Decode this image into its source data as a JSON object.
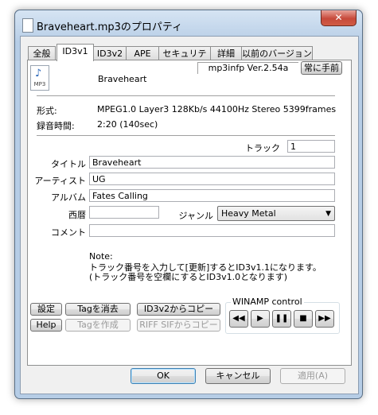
{
  "window": {
    "title": "Braveheart.mp3のプロパティ",
    "close_label": "✕"
  },
  "tabs": [
    "全般",
    "ID3v1",
    "ID3v2",
    "APE",
    "セキュリティ",
    "詳細",
    "以前のバージョン"
  ],
  "version": "mp3infp Ver.2.54a",
  "always_on_top": "常に手前",
  "file": {
    "icon_label": "MP3",
    "name": "Braveheart"
  },
  "info": {
    "format_label": "形式:",
    "format_value": "MPEG1.0 Layer3 128Kb/s 44100Hz Stereo 5399frames",
    "duration_label": "録音時間:",
    "duration_value": "2:20 (140sec)"
  },
  "fields": {
    "track_label": "トラック",
    "track_value": "1",
    "title_label": "タイトル",
    "title_value": "Braveheart",
    "artist_label": "アーティスト",
    "artist_value": "UG",
    "album_label": "アルバム",
    "album_value": "Fates Calling",
    "year_label": "西暦",
    "year_value": "",
    "genre_label": "ジャンル",
    "genre_value": "Heavy Metal",
    "comment_label": "コメント",
    "comment_value": ""
  },
  "note": {
    "line1": "Note:",
    "line2": "トラック番号を入力して[更新]するとID3v1.1になります。",
    "line3": "(トラック番号を空欄にするとID3v1.0となります)"
  },
  "buttons": {
    "settings": "設定",
    "delete_tag": "Tagを消去",
    "copy_from_id3v2": "ID3v2からコピー",
    "help": "Help",
    "create_tag": "Tagを作成",
    "copy_from_riff": "RIFF SIFからコピー"
  },
  "winamp": {
    "title": "WINAMP control",
    "prev": "◀◀",
    "play": "▶",
    "pause": "❚❚",
    "stop": "■",
    "next": "▶▶"
  },
  "footer": {
    "ok": "OK",
    "cancel": "キャンセル",
    "apply": "適用(A)"
  }
}
